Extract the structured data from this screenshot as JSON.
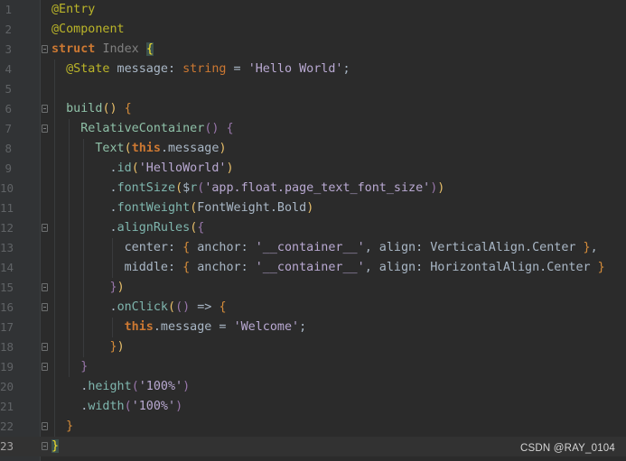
{
  "editor": {
    "current_line": 23,
    "lines": [
      {
        "n": "1",
        "fold": false,
        "tokens": [
          [
            "tk-annotation",
            "@Entry"
          ]
        ]
      },
      {
        "n": "2",
        "fold": false,
        "tokens": [
          [
            "tk-annotation",
            "@Component"
          ]
        ]
      },
      {
        "n": "3",
        "fold": true,
        "tokens": [
          [
            "tk-keyword",
            "struct"
          ],
          [
            "tk-plain",
            " "
          ],
          [
            "tk-class",
            "Index"
          ],
          [
            "tk-plain",
            " "
          ],
          [
            "tk-brace-match",
            "{"
          ]
        ]
      },
      {
        "n": "4",
        "fold": false,
        "tokens": [
          [
            "tk-plain",
            "  "
          ],
          [
            "tk-annotation",
            "@State"
          ],
          [
            "tk-plain",
            " message: "
          ],
          [
            "tk-type",
            "string"
          ],
          [
            "tk-plain",
            " = "
          ],
          [
            "tk-pstr",
            "'Hello World'"
          ],
          [
            "tk-plain",
            ";"
          ]
        ]
      },
      {
        "n": "5",
        "fold": false,
        "tokens": []
      },
      {
        "n": "6",
        "fold": true,
        "tokens": [
          [
            "tk-plain",
            "  "
          ],
          [
            "tk-call",
            "build"
          ],
          [
            "tk-paren",
            "()"
          ],
          [
            "tk-plain",
            " "
          ],
          [
            "tk-rbrace",
            "{"
          ]
        ]
      },
      {
        "n": "7",
        "fold": true,
        "tokens": [
          [
            "tk-plain",
            "    "
          ],
          [
            "tk-call",
            "RelativeContainer"
          ],
          [
            "tk-lavender",
            "()"
          ],
          [
            "tk-plain",
            " "
          ],
          [
            "tk-lavender",
            "{"
          ]
        ]
      },
      {
        "n": "8",
        "fold": false,
        "tokens": [
          [
            "tk-plain",
            "      "
          ],
          [
            "tk-call",
            "Text"
          ],
          [
            "tk-paren",
            "("
          ],
          [
            "tk-this",
            "this"
          ],
          [
            "tk-plain",
            ".message"
          ],
          [
            "tk-paren",
            ")"
          ]
        ]
      },
      {
        "n": "9",
        "fold": false,
        "tokens": [
          [
            "tk-plain",
            "        ."
          ],
          [
            "tk-method",
            "id"
          ],
          [
            "tk-paren",
            "("
          ],
          [
            "tk-pstr",
            "'HelloWorld'"
          ],
          [
            "tk-paren",
            ")"
          ]
        ]
      },
      {
        "n": "10",
        "fold": false,
        "tokens": [
          [
            "tk-plain",
            "        ."
          ],
          [
            "tk-method",
            "fontSize"
          ],
          [
            "tk-paren",
            "("
          ],
          [
            "tk-plain",
            "$"
          ],
          [
            "tk-method",
            "r"
          ],
          [
            "tk-lavender",
            "("
          ],
          [
            "tk-pstr",
            "'app.float.page_text_font_size'"
          ],
          [
            "tk-lavender",
            ")"
          ],
          [
            "tk-paren",
            ")"
          ]
        ]
      },
      {
        "n": "11",
        "fold": false,
        "tokens": [
          [
            "tk-plain",
            "        ."
          ],
          [
            "tk-method",
            "fontWeight"
          ],
          [
            "tk-paren",
            "("
          ],
          [
            "tk-plain",
            "FontWeight.Bold"
          ],
          [
            "tk-paren",
            ")"
          ]
        ]
      },
      {
        "n": "12",
        "fold": true,
        "tokens": [
          [
            "tk-plain",
            "        ."
          ],
          [
            "tk-method",
            "alignRules"
          ],
          [
            "tk-paren",
            "("
          ],
          [
            "tk-lavender",
            "{"
          ]
        ]
      },
      {
        "n": "13",
        "fold": false,
        "tokens": [
          [
            "tk-plain",
            "          center: "
          ],
          [
            "tk-rbrace",
            "{"
          ],
          [
            "tk-plain",
            " anchor: "
          ],
          [
            "tk-pstr",
            "'__container__'"
          ],
          [
            "tk-plain",
            ", align: VerticalAlign.Center "
          ],
          [
            "tk-rbrace",
            "}"
          ],
          [
            "tk-plain",
            ","
          ]
        ]
      },
      {
        "n": "14",
        "fold": false,
        "tokens": [
          [
            "tk-plain",
            "          middle: "
          ],
          [
            "tk-rbrace",
            "{"
          ],
          [
            "tk-plain",
            " anchor: "
          ],
          [
            "tk-pstr",
            "'__container__'"
          ],
          [
            "tk-plain",
            ", align: HorizontalAlign.Center "
          ],
          [
            "tk-rbrace",
            "}"
          ]
        ]
      },
      {
        "n": "15",
        "fold": true,
        "tokens": [
          [
            "tk-plain",
            "        "
          ],
          [
            "tk-lavender",
            "}"
          ],
          [
            "tk-paren",
            ")"
          ]
        ]
      },
      {
        "n": "16",
        "fold": true,
        "tokens": [
          [
            "tk-plain",
            "        ."
          ],
          [
            "tk-method",
            "onClick"
          ],
          [
            "tk-paren",
            "("
          ],
          [
            "tk-lavender",
            "()"
          ],
          [
            "tk-plain",
            " => "
          ],
          [
            "tk-rbrace",
            "{"
          ]
        ]
      },
      {
        "n": "17",
        "fold": false,
        "tokens": [
          [
            "tk-plain",
            "          "
          ],
          [
            "tk-this",
            "this"
          ],
          [
            "tk-plain",
            ".message = "
          ],
          [
            "tk-pstr",
            "'Welcome'"
          ],
          [
            "tk-plain",
            ";"
          ]
        ]
      },
      {
        "n": "18",
        "fold": true,
        "tokens": [
          [
            "tk-plain",
            "        "
          ],
          [
            "tk-rbrace",
            "}"
          ],
          [
            "tk-paren",
            ")"
          ]
        ]
      },
      {
        "n": "19",
        "fold": true,
        "tokens": [
          [
            "tk-plain",
            "    "
          ],
          [
            "tk-lavender",
            "}"
          ]
        ]
      },
      {
        "n": "20",
        "fold": false,
        "tokens": [
          [
            "tk-plain",
            "    ."
          ],
          [
            "tk-method",
            "height"
          ],
          [
            "tk-lavender",
            "("
          ],
          [
            "tk-pstr",
            "'100%'"
          ],
          [
            "tk-lavender",
            ")"
          ]
        ]
      },
      {
        "n": "21",
        "fold": false,
        "tokens": [
          [
            "tk-plain",
            "    ."
          ],
          [
            "tk-method",
            "width"
          ],
          [
            "tk-lavender",
            "("
          ],
          [
            "tk-pstr",
            "'100%'"
          ],
          [
            "tk-lavender",
            ")"
          ]
        ]
      },
      {
        "n": "22",
        "fold": true,
        "tokens": [
          [
            "tk-plain",
            "  "
          ],
          [
            "tk-rbrace",
            "}"
          ]
        ]
      },
      {
        "n": "23",
        "fold": true,
        "tokens": [
          [
            "tk-brace-match",
            "}"
          ]
        ]
      }
    ]
  },
  "watermark": "CSDN @RAY_0104"
}
